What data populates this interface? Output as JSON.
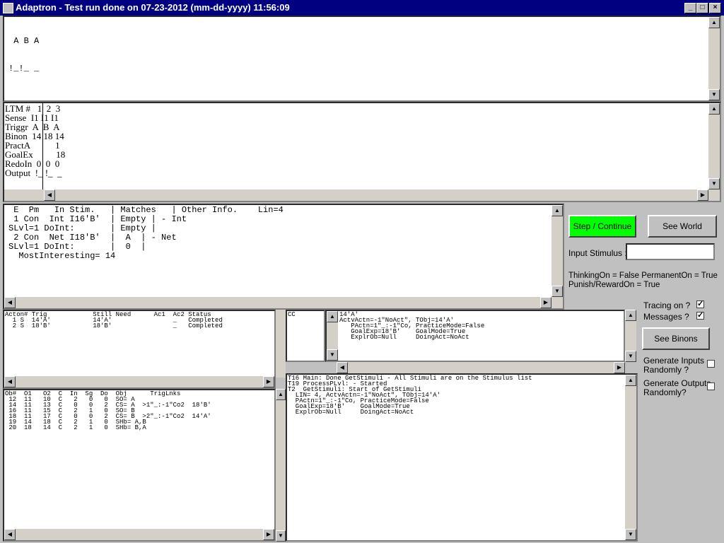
{
  "window": {
    "title": "Adaptron - Test run done on 07-23-2012 (mm-dd-yyyy) 11:56:09"
  },
  "world": {
    "line1": " A B A",
    "line2": "!_!_ _"
  },
  "ltm": {
    "rows": [
      "LTM #   1  2  3",
      "Sense  I1 I1 I1",
      "Triggr  A  B  A",
      "Binon  14 18 14",
      "PractA           1",
      "GoalEx          18",
      "RedoIn  0  0  0",
      "Output  !_ !_  _"
    ]
  },
  "stim": {
    "rows": [
      " E  Pm   In Stim.   | Matches   | Other Info.    Lin=4",
      " 1 Con  Int I16'B'  | Empty | - Int",
      "SLvl=1 DoInt:       | Empty |",
      " 2 Con  Net I18'B'  |  A  | - Net",
      "SLvl=1 DoInt:       |  0  |",
      "  MostInteresting= 14"
    ]
  },
  "actions": {
    "rows": [
      "Acton# Trig            Still Need      Ac1  Ac2 Status",
      "  1 S  14'A'           14'A'                _   Completed",
      "  2 S  18'B'           18'B'                _   Completed"
    ]
  },
  "objects": {
    "rows": [
      "Ob#  O1   O2  C  In  Sg  Do  Obj      TrigLnks",
      " 12  11   10  C   2   0   0  SO= A",
      " 14  11   13  C   0   0   2  CS= A  >1\"_:-1\"Co2  18'B'",
      " 16  11   15  C   2   1   0  SO= B",
      " 18  11   17  C   0   0   2  CS= B  >2\"_:-1\"Co2  14'A'",
      " 19  14   18  C   2   1   0  SHb= A,B",
      " 20  18   14  C   2   1   0  SHb= B,A"
    ]
  },
  "cc": {
    "label": "CC"
  },
  "info": {
    "rows": [
      "14'A'",
      "ActvActn=-1\"NoAct\", TObj=14'A'",
      "   PActn=1\"_:-1\"Co, PracticeMode=False",
      "   GoalExp=18'B'    GoalMode=True",
      "   ExplrOb=Null     DoingAct=NoAct"
    ]
  },
  "trace": {
    "rows": [
      "T16 Main: Done GetStimuli - All Stimuli are on the Stimulus list",
      "T19 ProcessPLvl: - Started",
      "T2  GetStimuli: Start of GetStimuli",
      "  LIN= 4, ActvActn=-1\"NoAct\", TObj=14'A'",
      "  PActn=1\"_:-1\"Co, PracticeMode=False",
      "  GoalExp=18'B'    GoalMode=True",
      "  ExplrOb=Null     DoingAct=NoAct"
    ]
  },
  "controls": {
    "step_label": "Step / Continue",
    "step_color": "#00ff00",
    "see_world_label": "See World",
    "input_label": "Input Stimulus :",
    "input_value": "",
    "status_line1": "ThinkingOn = False   PermanentOn = True",
    "status_line2": "Punish/RewardOn = True",
    "tracing_label": "Tracing on ?",
    "tracing_checked": true,
    "messages_label": "Messages ?",
    "messages_checked": true,
    "see_binons_label": "See Binons",
    "gen_inputs_label1": "Generate Inputs",
    "gen_inputs_label2": "Randomly ?",
    "gen_inputs_checked": false,
    "gen_outputs_label1": "Generate Outputs",
    "gen_outputs_label2": "Randomly?",
    "gen_outputs_checked": false,
    "check_mark": "✓"
  }
}
